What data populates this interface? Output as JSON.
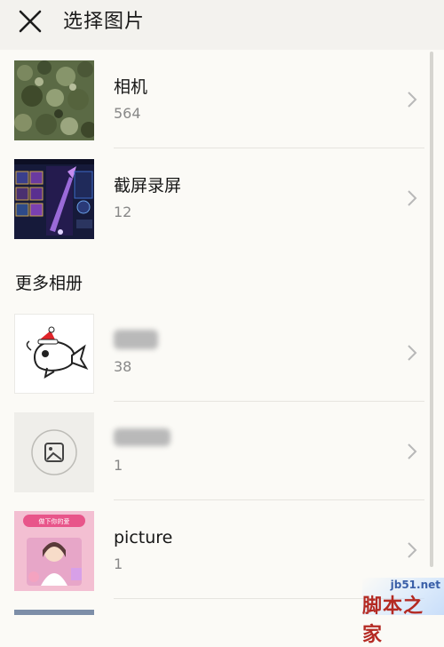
{
  "header": {
    "title": "选择图片",
    "close_icon": "close-icon"
  },
  "albums": [
    {
      "name": "相机",
      "count": "564",
      "thumb_icon": "photo-foliage"
    },
    {
      "name": "截屏录屏",
      "count": "12",
      "thumb_icon": "screenshot-game"
    }
  ],
  "section": {
    "label": "更多相册"
  },
  "more_albums": [
    {
      "name": "",
      "count": "38",
      "thumb_icon": "goldfish-sticker"
    },
    {
      "name": "",
      "count": "1",
      "thumb_icon": "image-icon"
    },
    {
      "name": "picture",
      "count": "1",
      "thumb_icon": "pink-poster"
    }
  ],
  "poster_text": "做下你的爱",
  "watermark": {
    "url": "jb51.net",
    "brand": "脚本之家"
  },
  "colors": {
    "background": "#fbfaf6",
    "header": "#f3f2ee",
    "divider": "#e6e4df",
    "count_gray": "#888888"
  }
}
